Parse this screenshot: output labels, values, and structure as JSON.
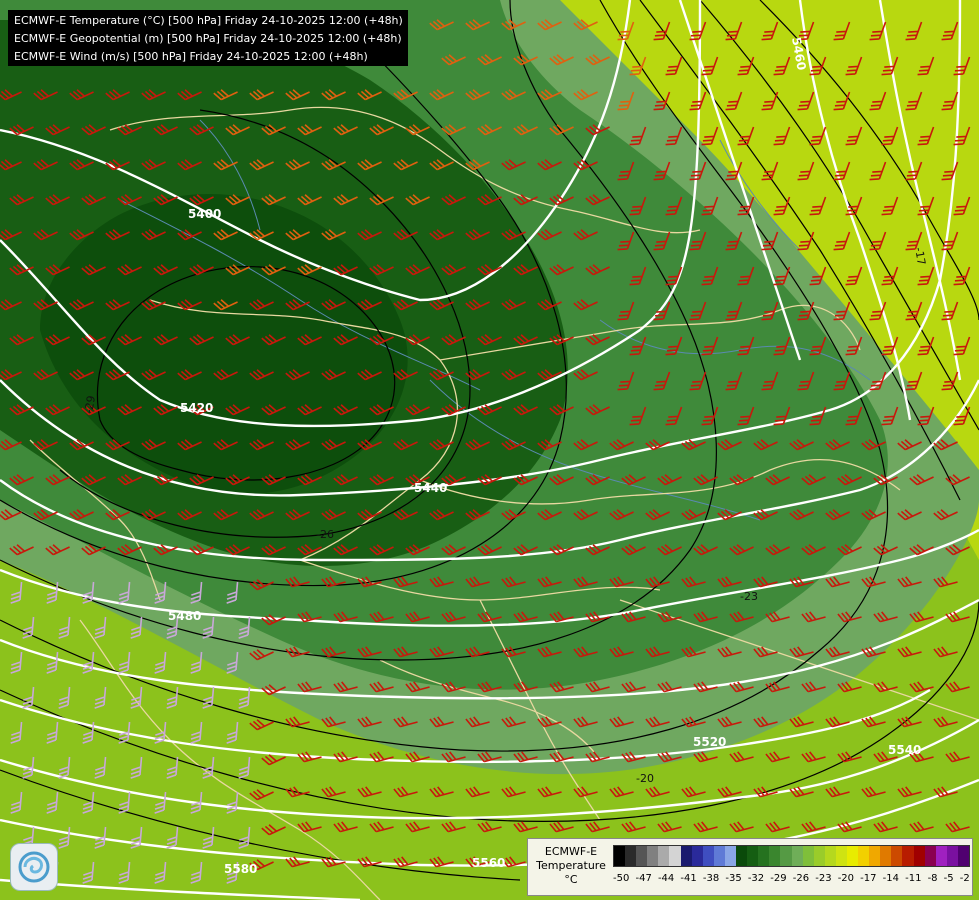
{
  "title": {
    "lines": [
      "ECMWF-E Temperature (°C) [500 hPa] Friday 24-10-2025 12:00 (+48h)",
      "ECMWF-E Geopotential (m) [500 hPa] Friday 24-10-2025 12:00 (+48h)",
      "ECMWF-E Wind (m/s) [500 hPa] Friday 24-10-2025 12:00 (+48h)"
    ]
  },
  "geopotential_labels": [
    "5400",
    "5420",
    "5440",
    "5480",
    "5520",
    "5540",
    "5560",
    "5580",
    "5460"
  ],
  "temperature_labels": [
    "-29",
    "-26",
    "-23",
    "-20",
    "-17"
  ],
  "legend": {
    "label_line1": "ECMWF-E",
    "label_line2": "Temperature",
    "label_line3": "°C",
    "ticks": [
      "-50",
      "-47",
      "-44",
      "-41",
      "-38",
      "-35",
      "-32",
      "-29",
      "-26",
      "-23",
      "-20",
      "-17",
      "-14",
      "-11",
      "-8",
      "-5",
      "-2"
    ],
    "colors": [
      "#000000",
      "#2a2a2a",
      "#555555",
      "#808080",
      "#aaaaaa",
      "#d4d4d4",
      "#1a1a6e",
      "#2a2a9a",
      "#3f4ec0",
      "#5f7ad6",
      "#8aa6e6",
      "#0a4a0a",
      "#155e12",
      "#25721f",
      "#3a862e",
      "#559a44",
      "#6fae58",
      "#7fbf3a",
      "#9acc2a",
      "#b5d81e",
      "#cfe312",
      "#e8ec00",
      "#f2d000",
      "#f0a800",
      "#e07a00",
      "#cc4a00",
      "#b81c00",
      "#a00000",
      "#8a0050",
      "#a020c0",
      "#7a10a0",
      "#500070"
    ]
  },
  "colors": {
    "dark_green": "#0f5a10",
    "mid_green": "#3f8a3a",
    "light_green": "#6fa860",
    "lime": "#8cc21c",
    "yellow_green": "#b8d810",
    "barb_red": "#c8180c",
    "barb_orange": "#e06010",
    "barb_lilac": "#c8a8d8",
    "border": "#e8d8a0",
    "river": "#5a8ab0",
    "contour_height": "#ffffff",
    "contour_temp": "#000000"
  },
  "logo": {
    "icon": "swirl-logo-icon"
  }
}
